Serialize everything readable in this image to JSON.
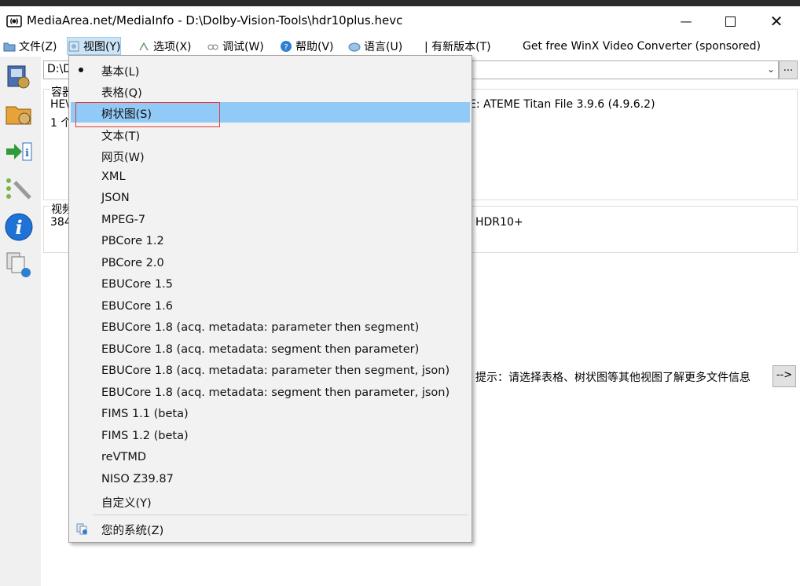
{
  "window": {
    "title": "MediaArea.net/MediaInfo - D:\\Dolby-Vision-Tools\\hdr10plus.hevc",
    "minimize": "—",
    "close": "✕"
  },
  "menubar": {
    "items": [
      {
        "label": "文件(Z)",
        "icon": "folder-icon"
      },
      {
        "label": "视图(Y)",
        "icon": "view-icon"
      },
      {
        "label": "选项(X)",
        "icon": "options-icon"
      },
      {
        "label": "调试(W)",
        "icon": "debug-icon"
      },
      {
        "label": "帮助(V)",
        "icon": "help-icon"
      },
      {
        "label": "语言(U)",
        "icon": "language-icon"
      },
      {
        "label": "| 有新版本(T)"
      },
      {
        "label": "Get free WinX Video Converter (sponsored)"
      }
    ]
  },
  "toolbar": {
    "icons": [
      "open-file-icon",
      "open-folder-icon",
      "export-icon",
      "preferences-icon",
      "info-icon",
      "about-icon"
    ]
  },
  "main": {
    "file_path": "D:\\D",
    "browse_label": "...",
    "container": {
      "heading": "容器",
      "line1_left": "HE\\",
      "line1_right": "E: ATEME Titan File 3.9.6 (4.9.6.2)",
      "line2": "1 个"
    },
    "video": {
      "heading": "视频",
      "line1_left": "384",
      "line1_right": "HDR10+"
    },
    "hint": "提示：请选择表格、树状图等其他视图了解更多文件信息",
    "hint_button": "-->"
  },
  "view_menu": {
    "items": [
      "基本(L)",
      "表格(Q)",
      "树状图(S)",
      "文本(T)",
      "网页(W)",
      "XML",
      "JSON",
      "MPEG-7",
      "PBCore 1.2",
      "PBCore 2.0",
      "EBUCore 1.5",
      "EBUCore 1.6",
      "EBUCore 1.8 (acq. metadata: parameter then segment)",
      "EBUCore 1.8 (acq. metadata: segment then parameter)",
      "EBUCore 1.8 (acq. metadata: parameter then segment, json)",
      "EBUCore 1.8 (acq. metadata: segment then parameter, json)",
      "FIMS 1.1 (beta)",
      "FIMS 1.2 (beta)",
      "reVTMD",
      "NISO Z39.87",
      "自定义(Y)"
    ],
    "selected_index": 0,
    "highlighted_index": 2,
    "system_item": "您的系统(Z)"
  },
  "colors": {
    "highlight": "#91c9f7",
    "annotation_box": "#e23b3b",
    "menu_background": "#f2f2f2"
  }
}
